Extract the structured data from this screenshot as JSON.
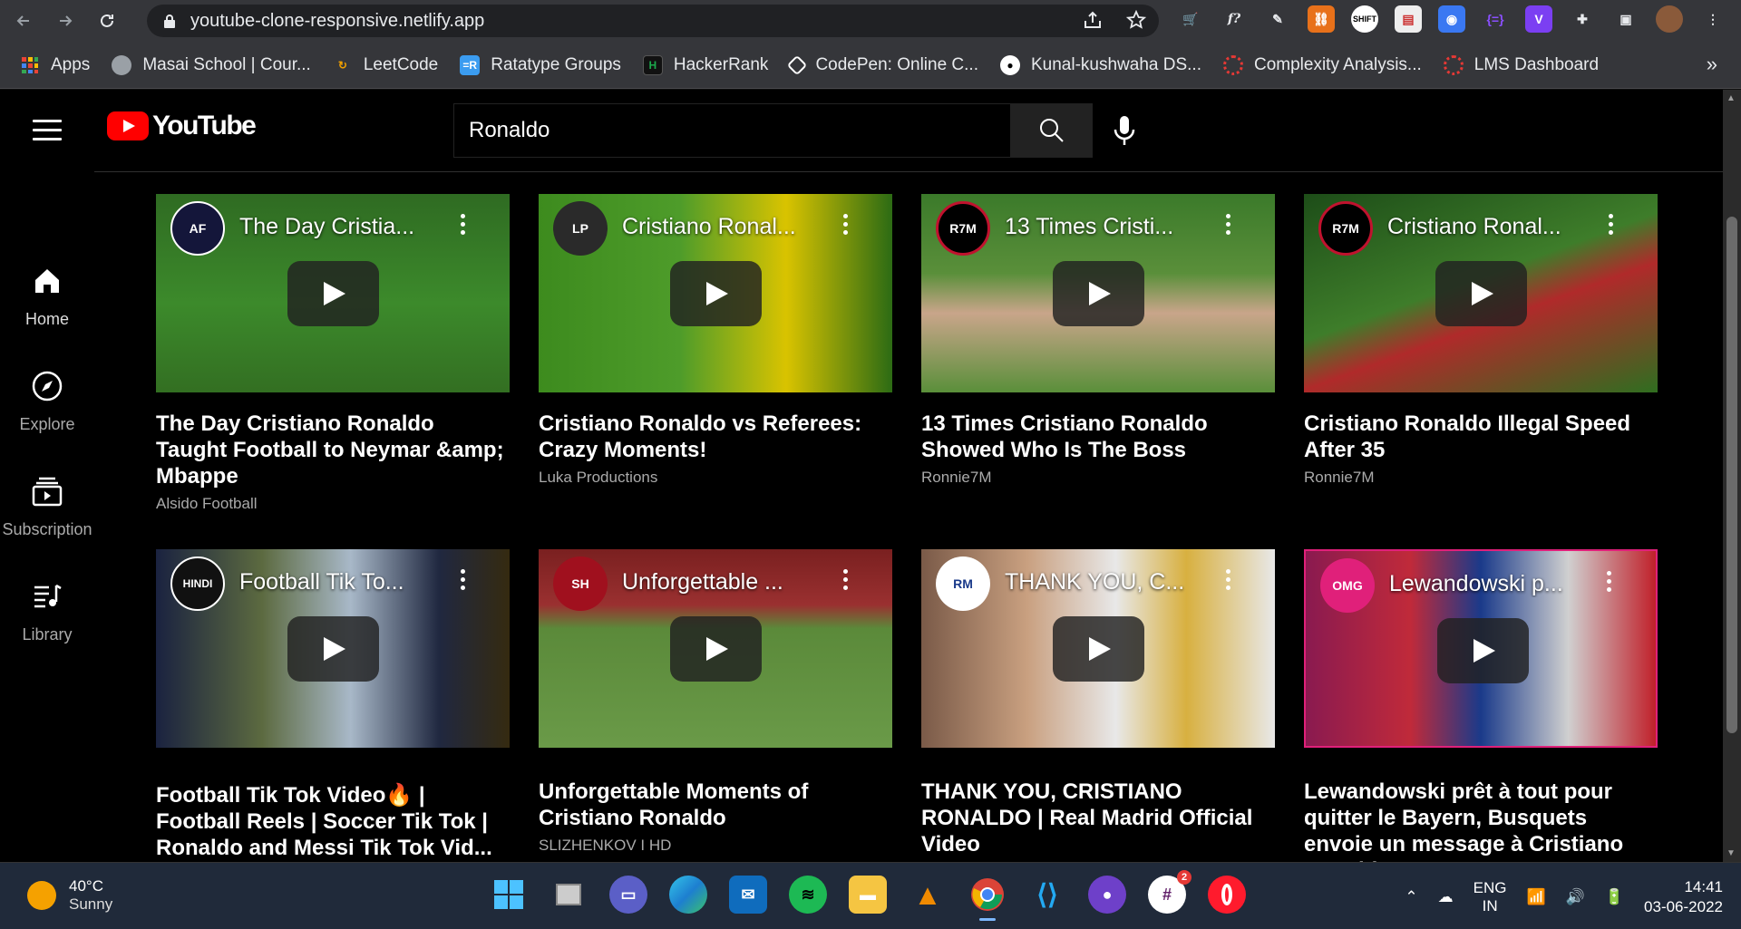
{
  "browser": {
    "url": "youtube-clone-responsive.netlify.app",
    "bookmarks": [
      {
        "label": "Apps",
        "icon": "apps-grid-icon",
        "color": "#ea4335"
      },
      {
        "label": "Masai School | Cour...",
        "icon": "globe-icon",
        "color": "#9aa0a6"
      },
      {
        "label": "LeetCode",
        "icon": "leetcode-icon",
        "color": "#f0a000"
      },
      {
        "label": "Ratatype Groups",
        "icon": "ratatype-icon",
        "color": "#3b9cf0"
      },
      {
        "label": "HackerRank",
        "icon": "hackerrank-icon",
        "color": "#1ba94c"
      },
      {
        "label": "CodePen: Online C...",
        "icon": "codepen-icon",
        "color": "#ffffff"
      },
      {
        "label": "Kunal-kushwaha DS...",
        "icon": "github-icon",
        "color": "#ffffff"
      },
      {
        "label": "Complexity Analysis...",
        "icon": "gear-red-icon",
        "color": "#e53935"
      },
      {
        "label": "LMS Dashboard",
        "icon": "gear-red-icon",
        "color": "#e53935"
      }
    ],
    "bookmarks_more": "»"
  },
  "youtube": {
    "logo_text": "YouTube",
    "search_value": "Ronaldo",
    "sidebar": [
      {
        "label": "Home",
        "icon": "home-icon"
      },
      {
        "label": "Explore",
        "icon": "compass-icon"
      },
      {
        "label": "Subscription",
        "icon": "subscriptions-icon"
      },
      {
        "label": "Library",
        "icon": "library-icon"
      }
    ],
    "videos": [
      {
        "overlay_title": "The Day Cristia...",
        "title": "The Day Cristiano Ronaldo Taught Football to Neymar &amp; Mbappe",
        "channel": "Alsido Football",
        "avatar_text": "AF",
        "avatar_color": "#1a1a3a"
      },
      {
        "overlay_title": "Cristiano Ronal...",
        "title": "Cristiano Ronaldo vs Referees: Crazy Moments!",
        "channel": "Luka Productions",
        "avatar_text": "LP",
        "avatar_color": "#333333"
      },
      {
        "overlay_title": "13 Times Cristi...",
        "title": "13 Times Cristiano Ronaldo Showed Who Is The Boss",
        "channel": "Ronnie7M",
        "avatar_text": "R7M",
        "avatar_color": "#c0122e"
      },
      {
        "overlay_title": "Cristiano Ronal...",
        "title": "Cristiano Ronaldo Illegal Speed After 35",
        "channel": "Ronnie7M",
        "avatar_text": "R7M",
        "avatar_color": "#c0122e"
      },
      {
        "overlay_title": "Football Tik To...",
        "title": "Football Tik Tok Video🔥 | Football Reels | Soccer Tik Tok | Ronaldo and Messi Tik Tok Vid...",
        "channel": "",
        "avatar_text": "HINDI",
        "avatar_color": "#111111"
      },
      {
        "overlay_title": "Unforgettable ...",
        "title": "Unforgettable Moments of Cristiano Ronaldo",
        "channel": "SLIZHENKOV I HD",
        "avatar_text": "SH",
        "avatar_color": "#a0101e"
      },
      {
        "overlay_title": "THANK YOU, C...",
        "title": "THANK YOU, CRISTIANO RONALDO | Real Madrid Official Video",
        "channel": "",
        "avatar_text": "RM",
        "avatar_color": "#ffffff"
      },
      {
        "overlay_title": "Lewandowski p...",
        "title": "Lewandowski prêt à tout pour quitter le Bayern, Busquets envoie un message à Cristiano Ronaldo",
        "channel": "",
        "avatar_text": "OMG",
        "avatar_color": "#e0207a"
      }
    ]
  },
  "taskbar": {
    "temperature": "40°C",
    "condition": "Sunny",
    "lang_top": "ENG",
    "lang_bottom": "IN",
    "time": "14:41",
    "date": "03-06-2022",
    "notif_badge": "2"
  }
}
